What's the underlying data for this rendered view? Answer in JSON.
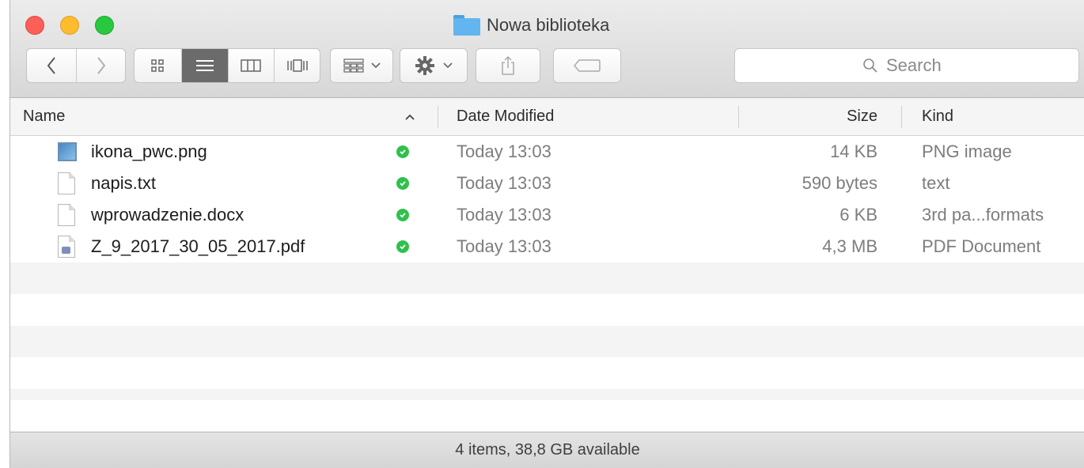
{
  "window": {
    "title": "Nowa biblioteka"
  },
  "toolbar": {
    "back_glyph": "‹",
    "forward_glyph": "›",
    "views": [
      {
        "icon": "icon-view-icon",
        "active": false
      },
      {
        "icon": "list-view-icon",
        "active": true
      },
      {
        "icon": "column-view-icon",
        "active": false
      },
      {
        "icon": "cover-flow-view-icon",
        "active": false
      }
    ],
    "search": {
      "placeholder": "Search",
      "value": ""
    }
  },
  "columns": {
    "name": "Name",
    "date": "Date Modified",
    "size": "Size",
    "kind": "Kind",
    "sort_indicator": "^"
  },
  "files": [
    {
      "name": "ikona_pwc.png",
      "date": "Today 13:03",
      "size": "14 KB",
      "kind": "PNG image",
      "icon": "image-file-icon"
    },
    {
      "name": "napis.txt",
      "date": "Today 13:03",
      "size": "590 bytes",
      "kind": "text",
      "icon": "text-file-icon"
    },
    {
      "name": "wprowadzenie.docx",
      "date": "Today 13:03",
      "size": "6 KB",
      "kind": "3rd pa...formats",
      "icon": "document-file-icon"
    },
    {
      "name": "Z_9_2017_30_05_2017.pdf",
      "date": "Today 13:03",
      "size": "4,3 MB",
      "kind": "PDF Document",
      "icon": "pdf-file-icon"
    }
  ],
  "status": {
    "text": "4 items, 38,8 GB available"
  },
  "colors": {
    "sync_ok": "#2fc14c",
    "active_view": "#6b6b6b"
  }
}
